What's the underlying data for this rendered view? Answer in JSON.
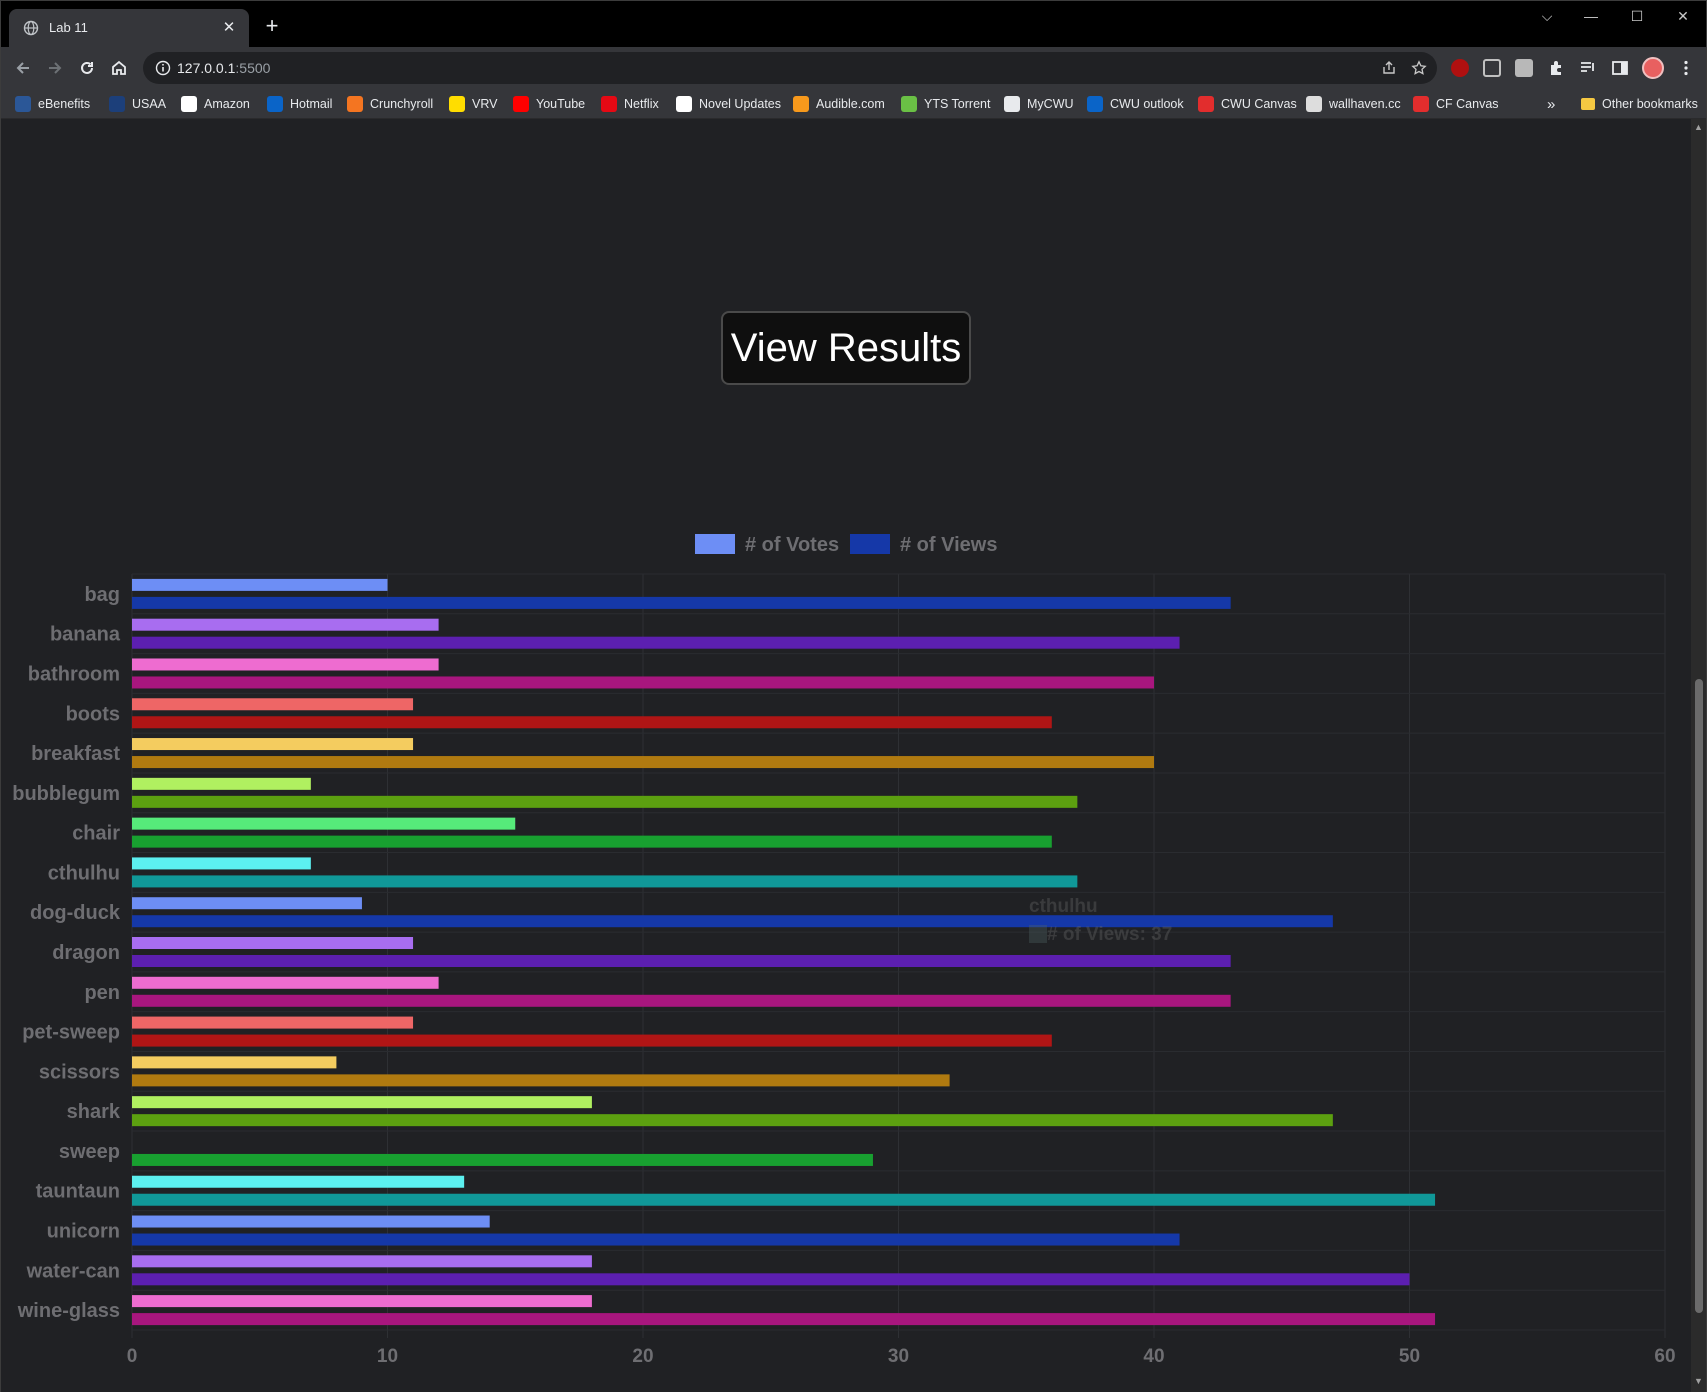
{
  "browser": {
    "tab_title": "Lab 11",
    "tab_close": "✕",
    "new_tab": "+",
    "url_host": "127.0.0.1",
    "url_port": ":5500",
    "window_controls": {
      "dropdown": "⌵",
      "minimize": "—",
      "maximize": "☐",
      "close": "✕"
    }
  },
  "bookmarks": [
    {
      "label": "eBenefits",
      "icon": "ebenefits-icon",
      "color": "#2b5797"
    },
    {
      "label": "USAA",
      "icon": "usaa-icon",
      "color": "#1c3f7a"
    },
    {
      "label": "Amazon",
      "icon": "amazon-icon",
      "color": "#ffffff"
    },
    {
      "label": "Hotmail",
      "icon": "outlook-icon",
      "color": "#0a64c8"
    },
    {
      "label": "Crunchyroll",
      "icon": "crunchyroll-icon",
      "color": "#f47521"
    },
    {
      "label": "VRV",
      "icon": "vrv-icon",
      "color": "#ffdd00"
    },
    {
      "label": "YouTube",
      "icon": "youtube-icon",
      "color": "#ff0000"
    },
    {
      "label": "Netflix",
      "icon": "netflix-icon",
      "color": "#e50914"
    },
    {
      "label": "Novel Updates",
      "icon": "novelupdates-icon",
      "color": "#ffffff"
    },
    {
      "label": "Audible.com",
      "icon": "audible-icon",
      "color": "#f7991c"
    },
    {
      "label": "YTS Torrent",
      "icon": "yts-icon",
      "color": "#6ac045"
    },
    {
      "label": "MyCWU",
      "icon": "globe-icon",
      "color": "#e8eaed"
    },
    {
      "label": "CWU outlook",
      "icon": "outlook-icon",
      "color": "#0a64c8"
    },
    {
      "label": "CWU Canvas",
      "icon": "canvas-icon",
      "color": "#e22d2d"
    },
    {
      "label": "wallhaven.cc",
      "icon": "wallhaven-icon",
      "color": "#dddddd"
    },
    {
      "label": "CF Canvas",
      "icon": "canvas-icon",
      "color": "#e22d2d"
    }
  ],
  "other_bookmarks": "Other bookmarks",
  "overflow": "»",
  "page": {
    "button_label": "View Results"
  },
  "tooltip": {
    "title": "cthulhu",
    "body": "# of Views: 37"
  },
  "chart_data": {
    "type": "bar",
    "orientation": "horizontal",
    "categories": [
      "bag",
      "banana",
      "bathroom",
      "boots",
      "breakfast",
      "bubblegum",
      "chair",
      "cthulhu",
      "dog-duck",
      "dragon",
      "pen",
      "pet-sweep",
      "scissors",
      "shark",
      "sweep",
      "tauntaun",
      "unicorn",
      "water-can",
      "wine-glass"
    ],
    "series": [
      {
        "name": "# of Votes",
        "values": [
          10,
          12,
          12,
          11,
          11,
          7,
          15,
          7,
          9,
          11,
          12,
          11,
          8,
          18,
          0,
          13,
          14,
          18,
          18
        ]
      },
      {
        "name": "# of Views",
        "values": [
          43,
          41,
          40,
          36,
          40,
          37,
          36,
          37,
          47,
          43,
          43,
          36,
          32,
          47,
          29,
          51,
          41,
          50,
          51
        ]
      }
    ],
    "xlim": [
      0,
      60
    ],
    "xticks": [
      0,
      10,
      20,
      30,
      40,
      50,
      60
    ],
    "grid": true,
    "legend": "top",
    "legend_colors": [
      "#6d8ef5",
      "#1538a8"
    ],
    "palette_votes": [
      "#6d8ef5",
      "#a86df0",
      "#ee6cd0",
      "#ee6666",
      "#f4cc5f",
      "#b0f060",
      "#56ea7a",
      "#5cf0f0"
    ],
    "palette_views": [
      "#1538a8",
      "#5c1fb0",
      "#a8167e",
      "#b01515",
      "#b07a10",
      "#5ca010",
      "#18a030",
      "#109898"
    ]
  }
}
